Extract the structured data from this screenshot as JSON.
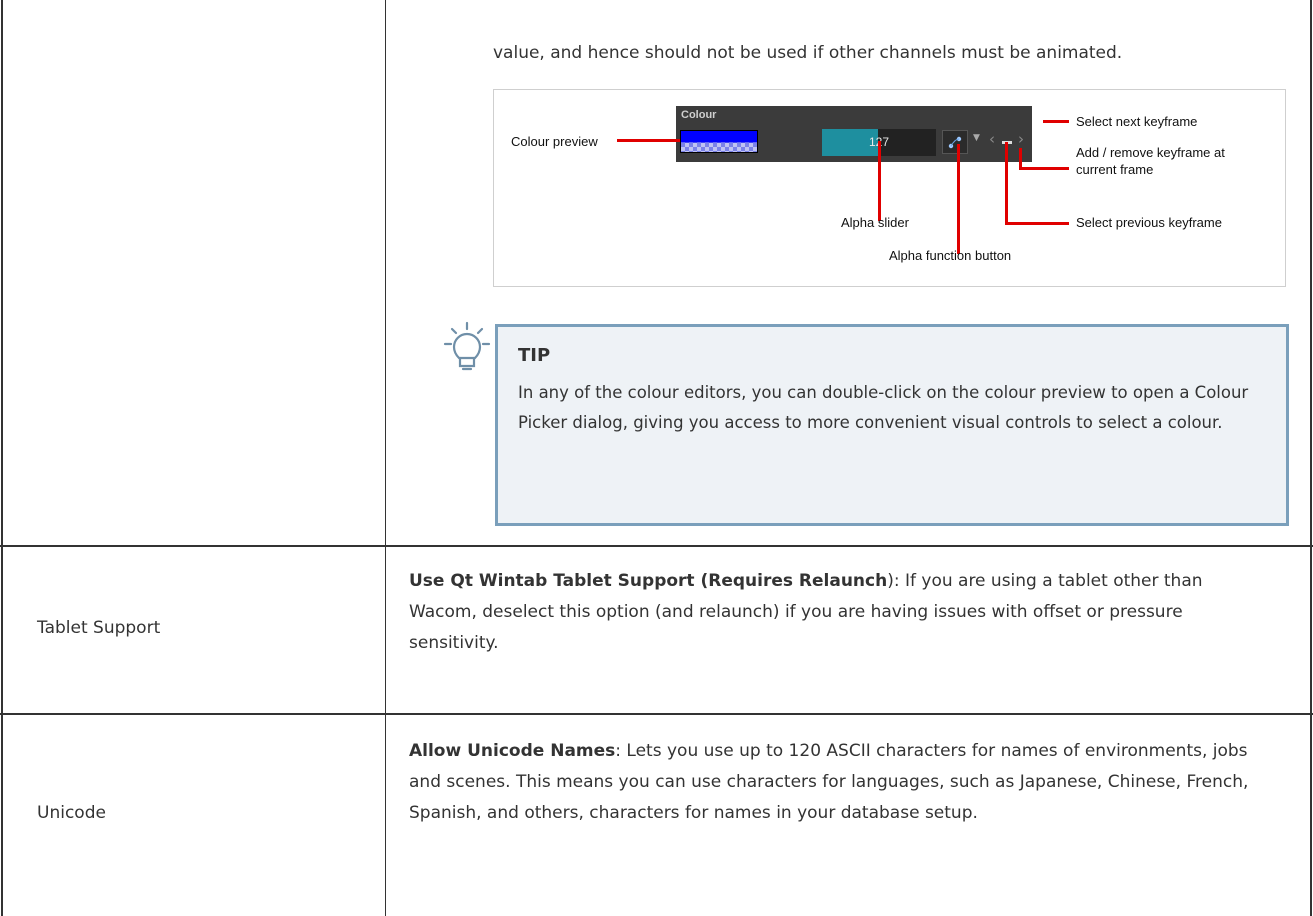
{
  "intro_text": "value, and hence should not be used if other channels must be animated.",
  "figure": {
    "panel_title": "Colour",
    "slider_value": "127",
    "alpha_fraction": 0.49,
    "labels": {
      "colour_preview": "Colour preview",
      "alpha_slider": "Alpha slider",
      "alpha_function_button": "Alpha function button",
      "select_next_keyframe": "Select next keyframe",
      "add_remove_keyframe_1": "Add / remove keyframe at",
      "add_remove_keyframe_2": "current frame",
      "select_previous_keyframe": "Select previous keyframe"
    },
    "colors": {
      "preview": "#0000ff",
      "slider": "#1e8f9f",
      "callout": "#e00000",
      "panel": "#3b3b3b"
    }
  },
  "tip": {
    "title": "TIP",
    "icon": "lightbulb-icon",
    "body": "In any of the colour editors, you can double-click on the colour preview to open a Colour Picker dialog, giving you access to more convenient visual controls to select a colour."
  },
  "rows": [
    {
      "label": "Tablet Support",
      "option": "Use Qt Wintab Tablet Support (Requires Relaunch",
      "desc": "): If you are using a tablet other than Wacom, deselect this option (and relaunch) if you are having issues with offset or pressure sensitivity."
    },
    {
      "label": "Unicode",
      "option": "Allow Unicode Names",
      "desc": ": Lets you use up to 120 ASCII characters for names of environments, jobs and scenes. This means you can use characters for languages, such as Japanese, Chinese, French, Spanish, and others, characters for names in your database setup."
    }
  ]
}
